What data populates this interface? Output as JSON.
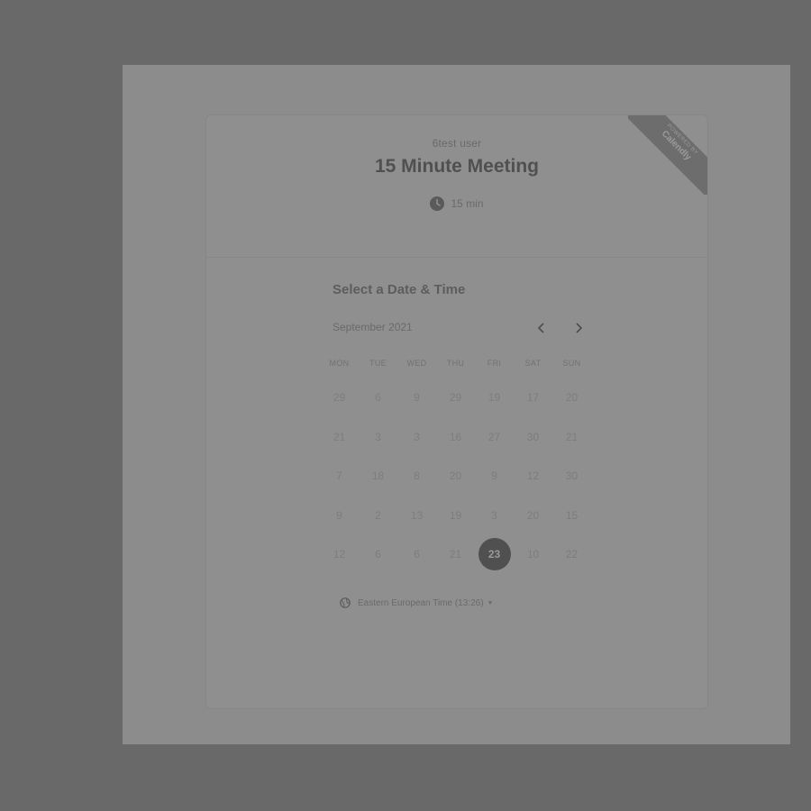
{
  "header": {
    "organizer": "6test user",
    "title": "15 Minute Meeting",
    "duration": "15 min"
  },
  "badge": {
    "powered_by": "POWERED BY",
    "brand": "Calendly"
  },
  "picker": {
    "title": "Select a Date & Time",
    "month": "September 2021",
    "weekdays": [
      "MON",
      "TUE",
      "WED",
      "THU",
      "FRI",
      "SAT",
      "SUN"
    ],
    "weeks": [
      [
        "29",
        "6",
        "9",
        "29",
        "19",
        "17",
        "20"
      ],
      [
        "21",
        "3",
        "3",
        "16",
        "27",
        "30",
        "21"
      ],
      [
        "7",
        "18",
        "8",
        "20",
        "9",
        "12",
        "30"
      ],
      [
        "9",
        "2",
        "13",
        "19",
        "3",
        "20",
        "15"
      ],
      [
        "12",
        "6",
        "6",
        "21",
        "23",
        "10",
        "22"
      ]
    ],
    "selected_day": "23"
  },
  "timezone": {
    "label": "Eastern European Time (13:26)"
  },
  "icons": {
    "clock": "clock-icon",
    "prev": "chevron-left-icon",
    "next": "chevron-right-icon",
    "globe": "globe-icon",
    "caret": "caret-down-icon"
  },
  "colors": {
    "backdrop": "#696969",
    "panel": "#8c8c8c",
    "card": "#8f8f8f",
    "selected_day": "#505050",
    "ribbon": "#6d6d6d"
  }
}
